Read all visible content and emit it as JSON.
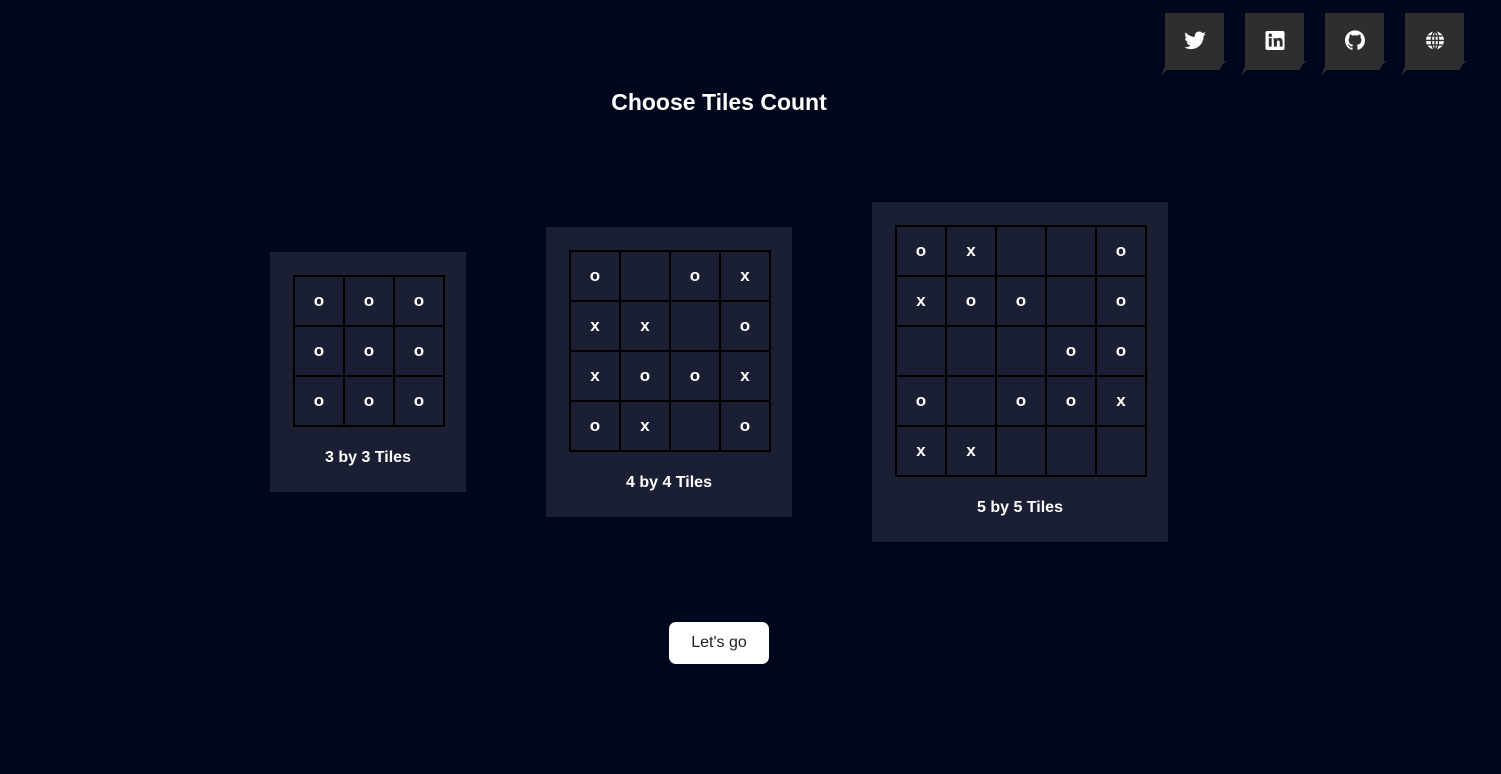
{
  "title": "Choose Tiles Count",
  "social": [
    {
      "name": "twitter",
      "icon": "twitter-icon"
    },
    {
      "name": "linkedin",
      "icon": "linkedin-icon"
    },
    {
      "name": "github",
      "icon": "github-icon"
    },
    {
      "name": "website",
      "icon": "globe-icon"
    }
  ],
  "boards": [
    {
      "label": "3 by 3 Tiles",
      "size": 3,
      "cells": [
        "o",
        "o",
        "o",
        "o",
        "o",
        "o",
        "o",
        "o",
        "o"
      ]
    },
    {
      "label": "4 by 4 Tiles",
      "size": 4,
      "cells": [
        "o",
        "",
        "o",
        "x",
        "x",
        "x",
        "",
        "o",
        "x",
        "o",
        "o",
        "x",
        "o",
        "x",
        "",
        "o"
      ]
    },
    {
      "label": "5 by 5 Tiles",
      "size": 5,
      "cells": [
        "o",
        "x",
        "",
        "",
        "o",
        "x",
        "o",
        "o",
        "",
        "o",
        "",
        "",
        "",
        "o",
        "o",
        "o",
        "",
        "o",
        "o",
        "x",
        "x",
        "x",
        "",
        "",
        ""
      ]
    }
  ],
  "action": {
    "label": "Let's go"
  },
  "colors": {
    "background": "#00061c",
    "card": "#1a1f33",
    "social_plate": "#2e2e2e",
    "button": "#ffffff"
  }
}
